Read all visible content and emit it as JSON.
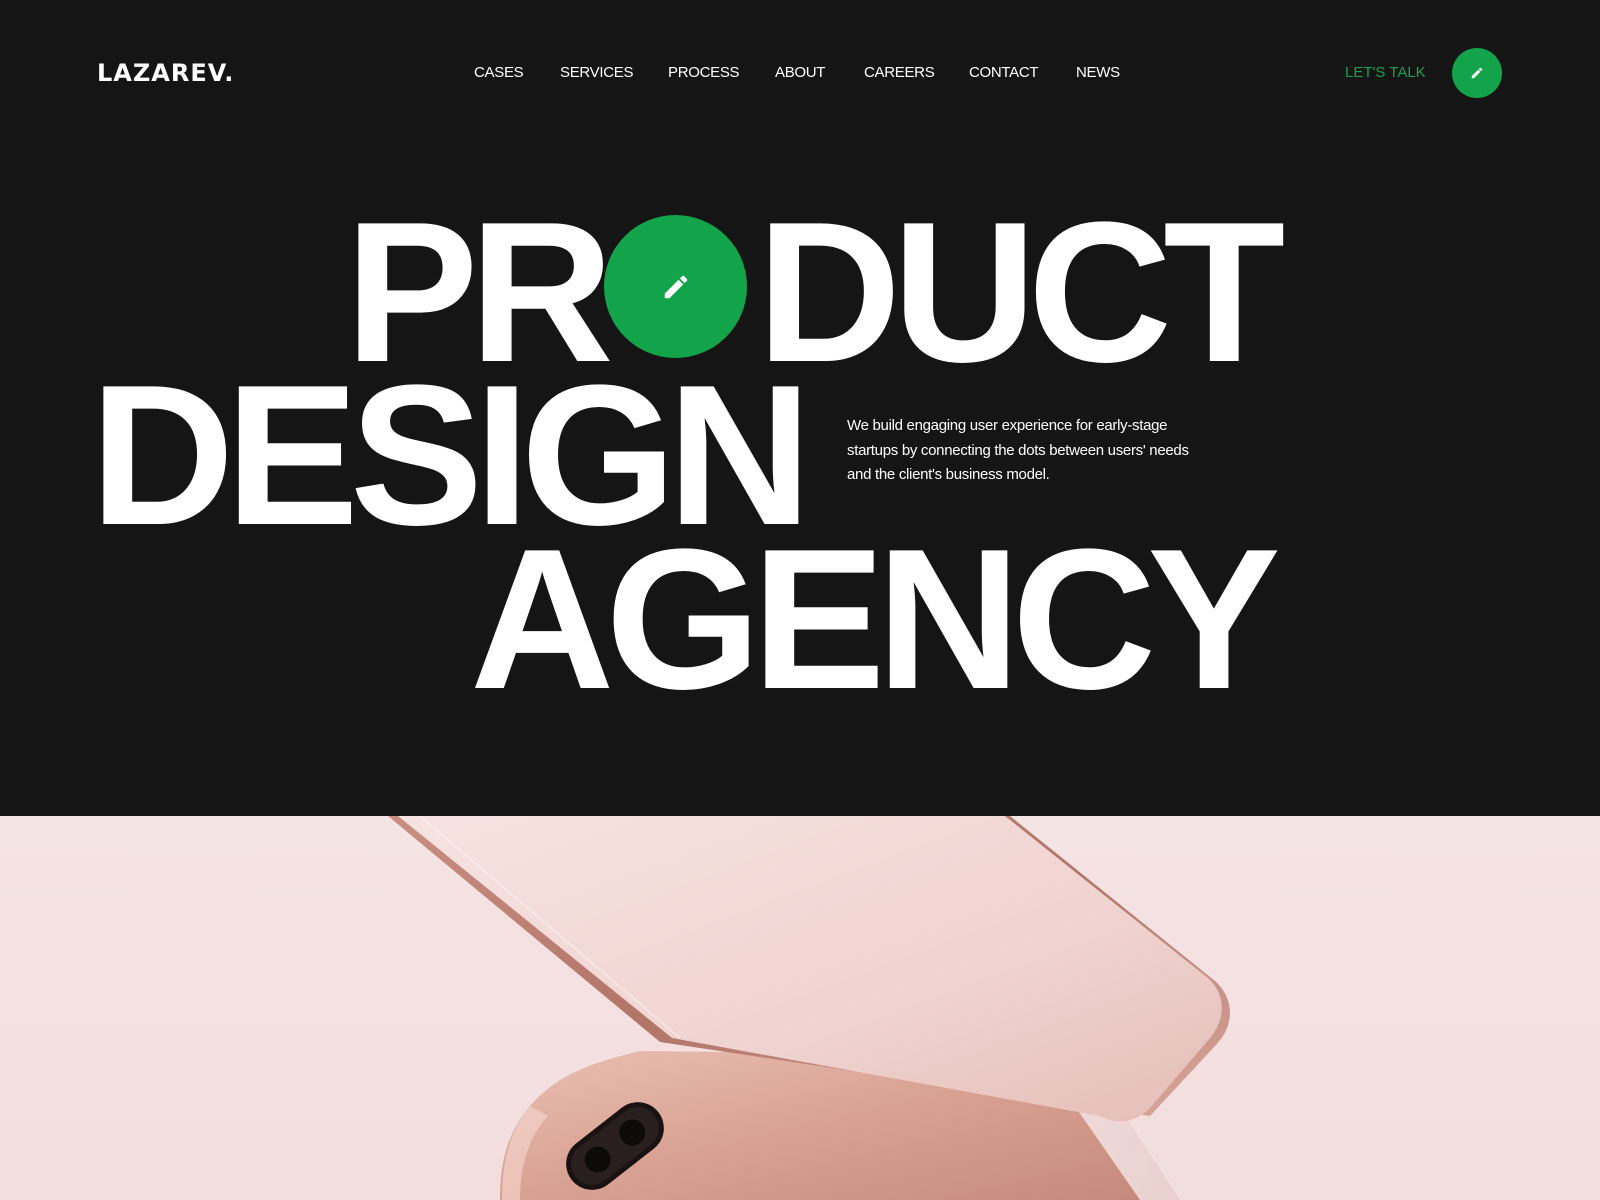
{
  "brand": {
    "logo": "LAZAREV."
  },
  "nav": {
    "items": [
      {
        "label": "CASES"
      },
      {
        "label": "SERVICES"
      },
      {
        "label": "PROCESS"
      },
      {
        "label": "ABOUT"
      },
      {
        "label": "CAREERS"
      },
      {
        "label": "CONTACT"
      },
      {
        "label": "NEWS"
      }
    ],
    "cta_label": "LET'S TALK",
    "cta_icon": "pencil-icon"
  },
  "hero": {
    "headline": {
      "line1_before": "PR",
      "line1_after": "DUCT",
      "line2": "DESIGN",
      "line3": "AGENCY"
    },
    "o_icon": "pencil-icon",
    "tagline": "We build engaging user experience for early-stage startups by connecting the dots between users' needs and the client's business model."
  },
  "showcase": {
    "image": "rose-gold-phone"
  },
  "colors": {
    "background": "#151515",
    "accent": "#13a34a",
    "text": "#ffffff",
    "showcase_bg": "#f5e4e4"
  }
}
